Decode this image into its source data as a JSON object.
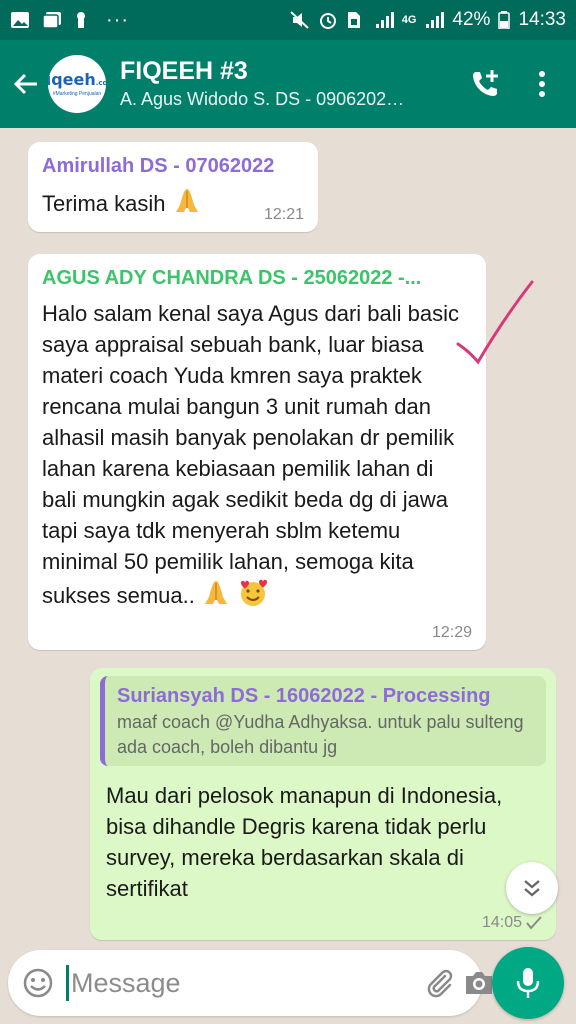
{
  "status_bar": {
    "battery": "42%",
    "time": "14:33",
    "network": "4G"
  },
  "header": {
    "avatar_logo": "fiqeeh",
    "avatar_logo_suffix": ".com",
    "avatar_tagline": "#Marketing Penjualan",
    "title": "FIQEEH #3",
    "subtitle": "A. Agus Widodo S. DS - 0906202…"
  },
  "messages": [
    {
      "sender": "Amirullah DS - 07062022",
      "sender_color": "#8e6bd6",
      "text": "Terima kasih",
      "time": "12:21"
    },
    {
      "sender": "AGUS ADY CHANDRA DS - 25062022 -...",
      "sender_color": "#3cc46a",
      "text": "Halo salam kenal saya Agus dari bali basic saya appraisal sebuah bank, luar biasa materi coach Yuda kmren saya praktek rencana mulai bangun 3 unit rumah dan alhasil masih banyak penolakan dr pemilik lahan karena kebiasaan pemilik lahan di bali mungkin agak sedikit beda dg di jawa tapi saya tdk menyerah sblm ketemu minimal 50 pemilik lahan, semoga kita sukses semua..",
      "time": "12:29"
    },
    {
      "quote_sender": "Suriansyah DS - 16062022 - Processing",
      "quote_text": "maaf coach @Yudha Adhyaksa.  untuk palu sulteng ada coach, boleh dibantu jg",
      "text": "Mau dari pelosok manapun di Indonesia, bisa dihandle Degris karena tidak perlu survey, mereka berdasarkan skala di sertifikat",
      "time": "14:05"
    }
  ],
  "input": {
    "placeholder": "Message"
  },
  "colors": {
    "header": "#00806a",
    "status_bar": "#006b5a",
    "outgoing_bubble": "#dcf8c6",
    "mic_button": "#00a884"
  },
  "icons": [
    "image-icon",
    "gallery-icon",
    "lock-icon",
    "more-dots-icon",
    "mute-icon",
    "alarm-icon",
    "sim-icon",
    "signal-icon",
    "battery-icon",
    "back-arrow-icon",
    "add-call-icon",
    "menu-dots-icon",
    "pray-emoji",
    "smiling-hearts-emoji",
    "check-icon",
    "scroll-down-icon",
    "emoji-icon",
    "attach-icon",
    "camera-icon",
    "mic-icon"
  ]
}
